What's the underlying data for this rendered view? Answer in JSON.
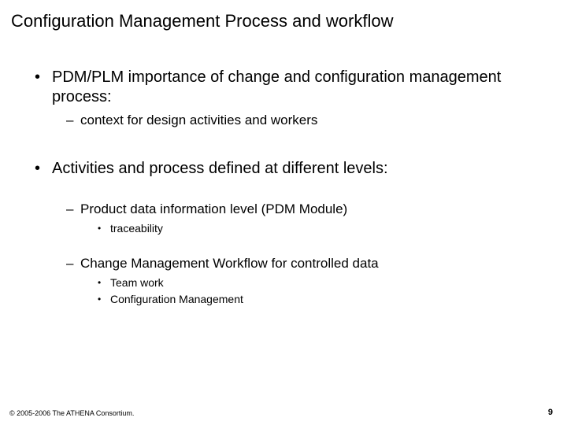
{
  "title": "Configuration Management Process and workflow",
  "bullets": {
    "b1": "PDM/PLM importance of change and configuration management process:",
    "b1_1": "context for design activities and  workers",
    "b2": "Activities and process defined at different levels:",
    "b2_1": "Product data information level (PDM Module)",
    "b2_1_1": "traceability",
    "b2_2": "Change Management Workflow for controlled data",
    "b2_2_1": "Team work",
    "b2_2_2": "Configuration Management"
  },
  "footer": {
    "copyright": "© 2005-2006 The ATHENA Consortium.",
    "page": "9"
  }
}
